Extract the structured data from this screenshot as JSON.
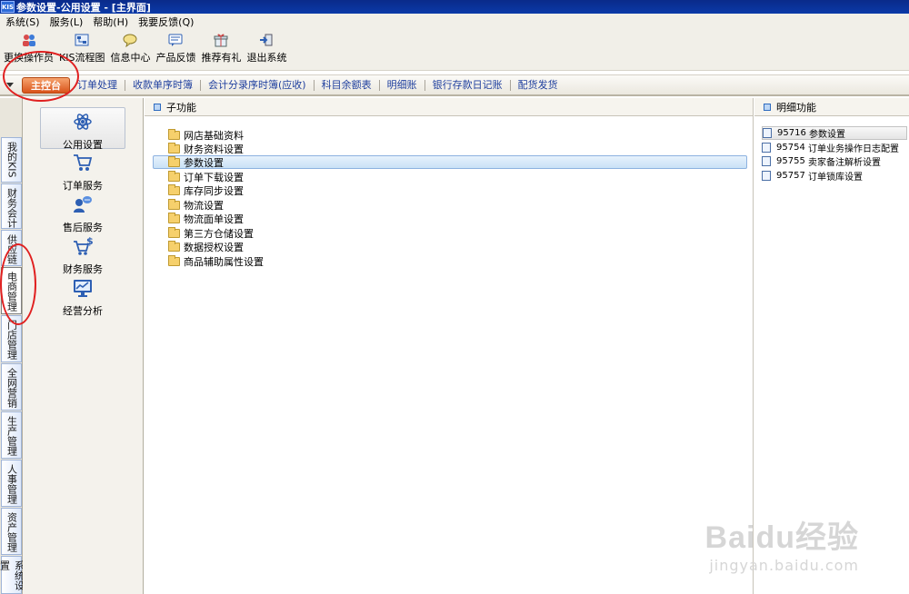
{
  "window": {
    "logo": "KIS",
    "title": "参数设置-公用设置 - [主界面]"
  },
  "menu": [
    "系统(S)",
    "服务(L)",
    "帮助(H)",
    "我要反馈(Q)"
  ],
  "toolbar": [
    {
      "label": "更换操作员",
      "icon": "users-icon"
    },
    {
      "label": "KIS流程图",
      "icon": "flowchart-icon"
    },
    {
      "label": "信息中心",
      "icon": "message-icon"
    },
    {
      "label": "产品反馈",
      "icon": "feedback-icon"
    },
    {
      "label": "推荐有礼",
      "icon": "gift-icon"
    },
    {
      "label": "退出系统",
      "icon": "exit-icon"
    }
  ],
  "tabs": {
    "main": "主控台",
    "links": [
      "订单处理",
      "收款单序时簿",
      "会计分录序时簿(应收)",
      "科目余额表",
      "明细账",
      "银行存款日记账",
      "配货发货"
    ]
  },
  "vertical_tabs": [
    "我的KIS",
    "财务会计",
    "供应链",
    "电商管理",
    "门店管理",
    "全网营销",
    "生产管理",
    "人事管理",
    "资产管理",
    "系统设置"
  ],
  "side_menu": [
    "公用设置",
    "订单服务",
    "售后服务",
    "财务服务",
    "经营分析"
  ],
  "sub_panel": {
    "title": "子功能",
    "items": [
      "网店基础资料",
      "财务资料设置",
      "参数设置",
      "订单下载设置",
      "库存同步设置",
      "物流设置",
      "物流面单设置",
      "第三方仓储设置",
      "数据授权设置",
      "商品辅助属性设置"
    ],
    "selected": "参数设置"
  },
  "detail_panel": {
    "title": "明细功能",
    "items": [
      {
        "code": "95716",
        "name": "参数设置"
      },
      {
        "code": "95754",
        "name": "订单业务操作日志配置"
      },
      {
        "code": "95755",
        "name": "卖家备注解析设置"
      },
      {
        "code": "95757",
        "name": "订单锁库设置"
      }
    ]
  },
  "watermark": {
    "line1": "Baidu经验",
    "line2": "jingyan.baidu.com"
  },
  "colors": {
    "accent_orange": "#d9531a",
    "link_blue": "#1f3f9e",
    "title_blue": "#0b3aa8",
    "annotation_red": "#e02020"
  }
}
